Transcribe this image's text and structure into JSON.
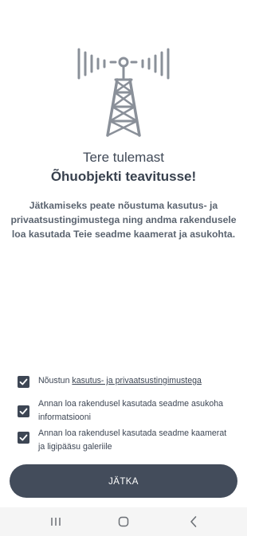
{
  "welcome": {
    "line1": "Tere tulemast",
    "line2": "Õhuobjekti teavitusse!"
  },
  "intro": "Jätkamiseks peate nõustuma kasutus- ja privaatsustingimustega ning andma rakendusele loa kasutada Teie seadme kaamerat ja asukohta.",
  "consents": [
    {
      "checked": true,
      "prefix": "Nõustun ",
      "link": "kasutus- ja privaatsustingimustega"
    },
    {
      "checked": true,
      "line1": "Annan loa rakendusel kasutada seadme asukoha",
      "line2": "informatsiooni"
    },
    {
      "checked": true,
      "line1": "Annan loa rakendusel kasutada seadme kaamerat",
      "line2": "ja ligipääsu galeriile"
    }
  ],
  "continue_label": "JÄTKA",
  "colors": {
    "primary": "#434c5b",
    "text": "#414a58",
    "icon": "#8a9099"
  },
  "icons": {
    "hero": "radio-tower-icon",
    "checkbox": "checkmark-icon",
    "nav_recent": "recent-apps-icon",
    "nav_home": "home-icon",
    "nav_back": "back-icon"
  }
}
